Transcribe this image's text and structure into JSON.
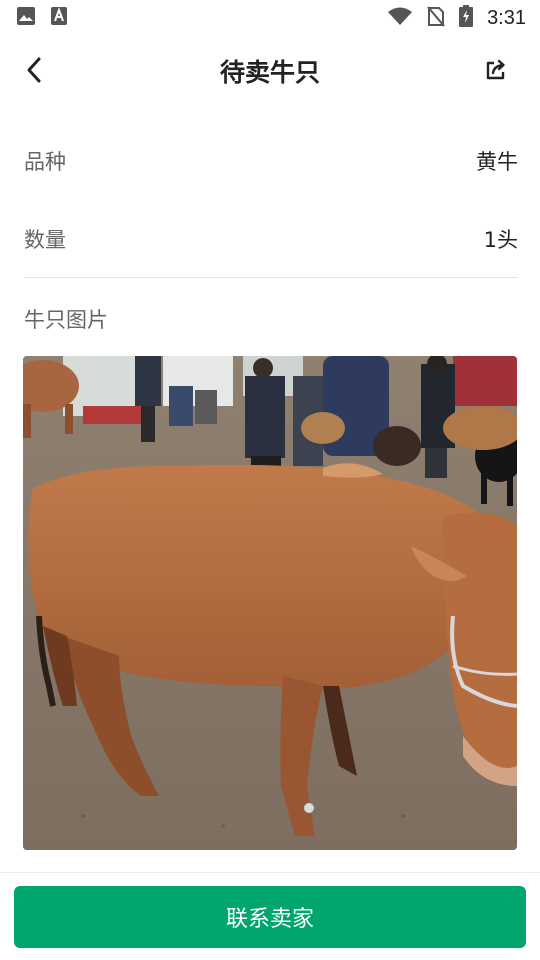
{
  "status_bar": {
    "time": "3:31",
    "icons": [
      "image-icon",
      "text-app-icon",
      "wifi-icon",
      "no-sim-icon",
      "battery-charging-icon"
    ]
  },
  "header": {
    "title": "待卖牛只",
    "back_icon": "chevron-left-icon",
    "share_icon": "share-icon"
  },
  "details": {
    "breed_label": "品种",
    "breed_value": "黄牛",
    "quantity_label": "数量",
    "quantity_value": "1头"
  },
  "photos": {
    "section_title": "牛只图片",
    "count": 1
  },
  "footer": {
    "contact_label": "联系卖家",
    "accent_color": "#00a56f"
  }
}
